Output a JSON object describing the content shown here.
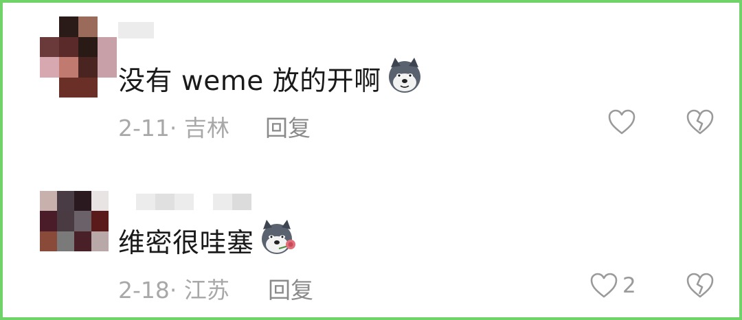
{
  "comments": [
    {
      "text": "没有 weme 放的开啊",
      "emoji": "husky-dog-emoji",
      "date": "2-11",
      "separator": "·",
      "location": "吉林",
      "reply_label": "回复",
      "like_count": ""
    },
    {
      "text": "维密很哇塞",
      "emoji": "husky-rose-emoji",
      "date": "2-18",
      "separator": "·",
      "location": "江苏",
      "reply_label": "回复",
      "like_count": "2"
    }
  ],
  "colors": {
    "border": "#6fd36a",
    "text": "#1a1a1a",
    "meta": "#a8a8a8",
    "icon": "#9a9a9a"
  }
}
